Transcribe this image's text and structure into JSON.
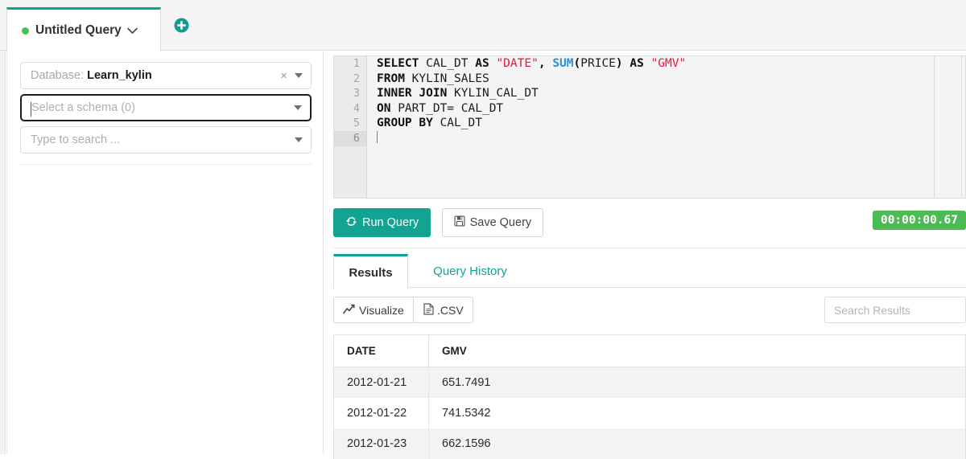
{
  "tabs": {
    "active_tab": {
      "label": "Untitled Query",
      "status_dot": "green-dot-icon",
      "chevron": "chevron-down-icon"
    },
    "new_tab_button": {
      "icon": "plus-circle-icon",
      "title": "New Query"
    }
  },
  "sidebar": {
    "database_select": {
      "prefix": "Database:",
      "value": "Learn_kylin",
      "clear": "×",
      "caret": "caret-down-icon"
    },
    "schema_select": {
      "placeholder": "Select a schema (0)",
      "caret": "caret-down-icon"
    },
    "table_select": {
      "placeholder": "Type to search ...",
      "caret": "caret-down-icon"
    }
  },
  "editor": {
    "line_numbers": [
      "1",
      "2",
      "3",
      "4",
      "5",
      "6"
    ],
    "active_line": 6,
    "sql_lines": [
      [
        {
          "t": "SELECT",
          "c": "kw"
        },
        {
          "t": " ",
          "c": "id"
        },
        {
          "t": "CAL_DT",
          "c": "id"
        },
        {
          "t": " ",
          "c": "id"
        },
        {
          "t": "AS",
          "c": "kw"
        },
        {
          "t": " ",
          "c": "id"
        },
        {
          "t": "\"DATE\"",
          "c": "str"
        },
        {
          "t": ", ",
          "c": "punc"
        },
        {
          "t": "SUM",
          "c": "fn"
        },
        {
          "t": "(",
          "c": "punc"
        },
        {
          "t": "PRICE",
          "c": "id"
        },
        {
          "t": ")",
          "c": "punc"
        },
        {
          "t": " ",
          "c": "id"
        },
        {
          "t": "AS",
          "c": "kw"
        },
        {
          "t": " ",
          "c": "id"
        },
        {
          "t": "\"GMV\"",
          "c": "str"
        }
      ],
      [
        {
          "t": "FROM",
          "c": "kw"
        },
        {
          "t": " ",
          "c": "id"
        },
        {
          "t": "KYLIN_SALES",
          "c": "id"
        }
      ],
      [
        {
          "t": "INNER JOIN",
          "c": "kw"
        },
        {
          "t": " ",
          "c": "id"
        },
        {
          "t": "KYLIN_CAL_DT",
          "c": "id"
        }
      ],
      [
        {
          "t": "ON",
          "c": "kw"
        },
        {
          "t": " ",
          "c": "id"
        },
        {
          "t": "PART_DT=",
          "c": "id"
        },
        {
          "t": " ",
          "c": "id"
        },
        {
          "t": "CAL_DT",
          "c": "id"
        }
      ],
      [
        {
          "t": "GROUP BY",
          "c": "kw"
        },
        {
          "t": " ",
          "c": "id"
        },
        {
          "t": "CAL_DT",
          "c": "id"
        }
      ],
      []
    ],
    "sql_text": "SELECT CAL_DT AS \"DATE\", SUM(PRICE) AS \"GMV\"\nFROM KYLIN_SALES\nINNER JOIN KYLIN_CAL_DT\nON PART_DT= CAL_DT\nGROUP BY CAL_DT\n"
  },
  "actions": {
    "run_query": {
      "label": "Run Query",
      "icon": "refresh-icon"
    },
    "save_query": {
      "label": "Save Query",
      "icon": "floppy-disk-icon"
    },
    "timer": "00:00:00.67"
  },
  "result_tabs": [
    {
      "label": "Results",
      "active": true
    },
    {
      "label": "Query History",
      "active": false
    }
  ],
  "results_toolbar": {
    "visualize": {
      "label": "Visualize",
      "icon": "line-chart-icon"
    },
    "csv": {
      "label": ".CSV",
      "icon": "file-document-icon"
    },
    "search": {
      "placeholder": "Search Results",
      "value": ""
    }
  },
  "results_table": {
    "columns": [
      "DATE",
      "GMV"
    ],
    "rows": [
      [
        "2012-01-21",
        "651.7491"
      ],
      [
        "2012-01-22",
        "741.5342"
      ],
      [
        "2012-01-23",
        "662.1596"
      ]
    ]
  },
  "colors": {
    "accent_teal": "#13a391",
    "status_green": "#4bbf57",
    "timer_green": "#4cbb53",
    "string_red": "#e8153f",
    "function_blue": "#2a8fd4"
  }
}
